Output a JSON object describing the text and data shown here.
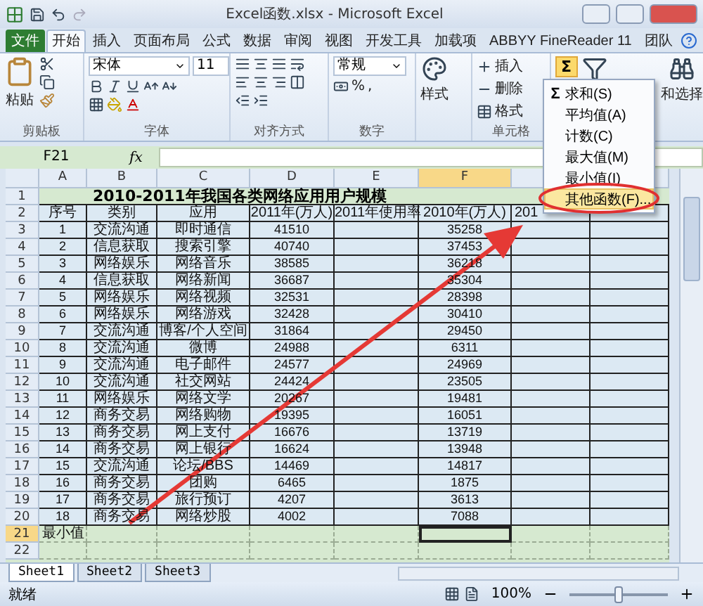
{
  "window": {
    "title": "Excel函数.xlsx - Microsoft Excel"
  },
  "ribbon_tabs": [
    {
      "label": "文件",
      "kind": "file",
      "selected": false
    },
    {
      "label": "开始",
      "kind": "tab",
      "selected": true
    },
    {
      "label": "插入",
      "kind": "tab",
      "selected": false
    },
    {
      "label": "页面布局",
      "kind": "tab",
      "selected": false
    },
    {
      "label": "公式",
      "kind": "tab",
      "selected": false
    },
    {
      "label": "数据",
      "kind": "tab",
      "selected": false
    },
    {
      "label": "审阅",
      "kind": "tab",
      "selected": false
    },
    {
      "label": "视图",
      "kind": "tab",
      "selected": false
    },
    {
      "label": "开发工具",
      "kind": "tab",
      "selected": false
    },
    {
      "label": "加载项",
      "kind": "tab",
      "selected": false
    },
    {
      "label": "ABBYY FineReader 11",
      "kind": "tab",
      "selected": false
    },
    {
      "label": "团队",
      "kind": "tab",
      "selected": false
    }
  ],
  "ribbon": {
    "clipboard": {
      "paste": "粘贴",
      "group": "剪贴板"
    },
    "font": {
      "name": "宋体",
      "size": "11",
      "group": "字体"
    },
    "alignment": {
      "group": "对齐方式"
    },
    "number": {
      "format": "常规",
      "percent": "%",
      "comma": ",",
      "group": "数字"
    },
    "styles": {
      "label": "样式"
    },
    "cells": {
      "items": [
        "插入",
        "删除",
        "格式"
      ],
      "group": "单元格"
    },
    "editing": {
      "sum": "Σ",
      "find": "和选择"
    }
  },
  "formula_bar": {
    "name_box": "F21",
    "fx": "fx"
  },
  "sheet": {
    "columns": [
      {
        "label": "A",
        "selected": false
      },
      {
        "label": "B",
        "selected": false
      },
      {
        "label": "C",
        "selected": false
      },
      {
        "label": "D",
        "selected": false
      },
      {
        "label": "E",
        "selected": false
      },
      {
        "label": "F",
        "selected": true
      }
    ],
    "title": "2010-2011年我国各类网络应用用户规模",
    "header": [
      "序号",
      "类别",
      "应用",
      "2011年(万人)",
      "2011年使用率",
      "2010年(万人)",
      "201"
    ],
    "rows": [
      [
        "1",
        "交流沟通",
        "即时通信",
        "41510",
        "35258"
      ],
      [
        "2",
        "信息获取",
        "搜索引擎",
        "40740",
        "37453"
      ],
      [
        "3",
        "网络娱乐",
        "网络音乐",
        "38585",
        "36218"
      ],
      [
        "4",
        "信息获取",
        "网络新闻",
        "36687",
        "35304"
      ],
      [
        "5",
        "网络娱乐",
        "网络视频",
        "32531",
        "28398"
      ],
      [
        "6",
        "网络娱乐",
        "网络游戏",
        "32428",
        "30410"
      ],
      [
        "7",
        "交流沟通",
        "博客/个人空间",
        "31864",
        "29450"
      ],
      [
        "8",
        "交流沟通",
        "微博",
        "24988",
        "6311"
      ],
      [
        "9",
        "交流沟通",
        "电子邮件",
        "24577",
        "24969"
      ],
      [
        "10",
        "交流沟通",
        "社交网站",
        "24424",
        "23505"
      ],
      [
        "11",
        "网络娱乐",
        "网络文学",
        "20267",
        "19481"
      ],
      [
        "12",
        "商务交易",
        "网络购物",
        "19395",
        "16051"
      ],
      [
        "13",
        "商务交易",
        "网上支付",
        "16676",
        "13719"
      ],
      [
        "14",
        "商务交易",
        "网上银行",
        "16624",
        "13948"
      ],
      [
        "15",
        "交流沟通",
        "论坛/BBS",
        "14469",
        "14817"
      ],
      [
        "16",
        "商务交易",
        "团购",
        "6465",
        "1875"
      ],
      [
        "17",
        "商务交易",
        "旅行预订",
        "4207",
        "3613"
      ],
      [
        "18",
        "商务交易",
        "网络炒股",
        "4002",
        "7088"
      ]
    ],
    "summary_label": "最小值",
    "row_headers": [
      {
        "label": "1",
        "selected": false
      },
      {
        "label": "2",
        "selected": false
      },
      {
        "label": "3",
        "selected": false
      },
      {
        "label": "4",
        "selected": false
      },
      {
        "label": "5",
        "selected": false
      },
      {
        "label": "6",
        "selected": false
      },
      {
        "label": "7",
        "selected": false
      },
      {
        "label": "8",
        "selected": false
      },
      {
        "label": "9",
        "selected": false
      },
      {
        "label": "10",
        "selected": false
      },
      {
        "label": "11",
        "selected": false
      },
      {
        "label": "12",
        "selected": false
      },
      {
        "label": "13",
        "selected": false
      },
      {
        "label": "14",
        "selected": false
      },
      {
        "label": "15",
        "selected": false
      },
      {
        "label": "16",
        "selected": false
      },
      {
        "label": "17",
        "selected": false
      },
      {
        "label": "18",
        "selected": false
      },
      {
        "label": "19",
        "selected": false
      },
      {
        "label": "20",
        "selected": false
      },
      {
        "label": "21",
        "selected": true
      },
      {
        "label": "22",
        "selected": false
      }
    ]
  },
  "autosum_menu": {
    "items": [
      {
        "label": "求和(S)",
        "kind": "sum",
        "icon": "Σ",
        "highlighted": false
      },
      {
        "label": "平均值(A)",
        "kind": "plain",
        "highlighted": false
      },
      {
        "label": "计数(C)",
        "kind": "plain",
        "highlighted": false
      },
      {
        "label": "最大值(M)",
        "kind": "plain",
        "highlighted": false
      },
      {
        "label": "最小值(I)",
        "kind": "plain",
        "highlighted": false
      },
      {
        "label": "其他函数(F)...",
        "kind": "plain",
        "highlighted": true
      }
    ]
  },
  "sheet_tabs": [
    {
      "label": "Sheet1",
      "selected": true
    },
    {
      "label": "Sheet2",
      "selected": false
    },
    {
      "label": "Sheet3",
      "selected": false
    }
  ],
  "status_bar": {
    "status": "就绪",
    "zoom": "100%",
    "zoom_slider": {
      "level": 0.5
    }
  }
}
